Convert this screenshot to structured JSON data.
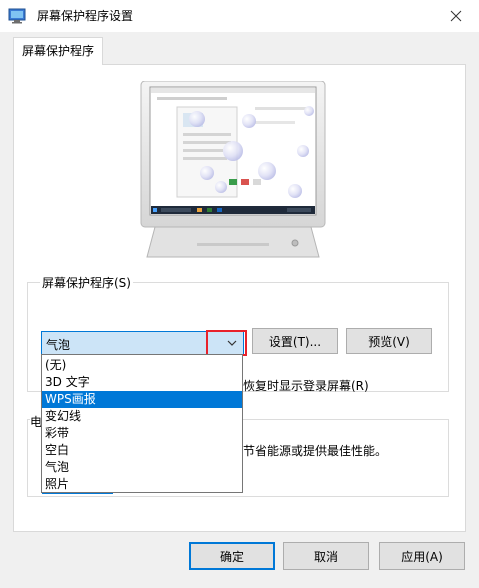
{
  "window": {
    "title": "屏幕保护程序设置",
    "icon": "monitor-app-icon",
    "close_icon": "close-icon"
  },
  "tabs": [
    {
      "label": "屏幕保护程序",
      "selected": true
    }
  ],
  "screensaver_group": {
    "legend": "屏幕保护程序(S)",
    "selected_value": "气泡",
    "settings_label": "设置(T)...",
    "preview_label": "预览(V)",
    "resume_text_partial": "恢复时显示登录屏幕(R)"
  },
  "dropdown": {
    "options": [
      "(无)",
      "3D 文字",
      "WPS画报",
      "变幻线",
      "彩带",
      "空白",
      "气泡",
      "照片"
    ],
    "highlighted": "WPS画报"
  },
  "power_group": {
    "label_partial": "电",
    "text_partial": "节省能源或提供最佳性能。"
  },
  "footer": {
    "ok_label": "确定",
    "cancel_label": "取消",
    "apply_label": "应用(A)"
  },
  "colors": {
    "accent": "#0078d7",
    "highlight_box": "#e8212b",
    "combo_bg": "#cce4f7"
  }
}
